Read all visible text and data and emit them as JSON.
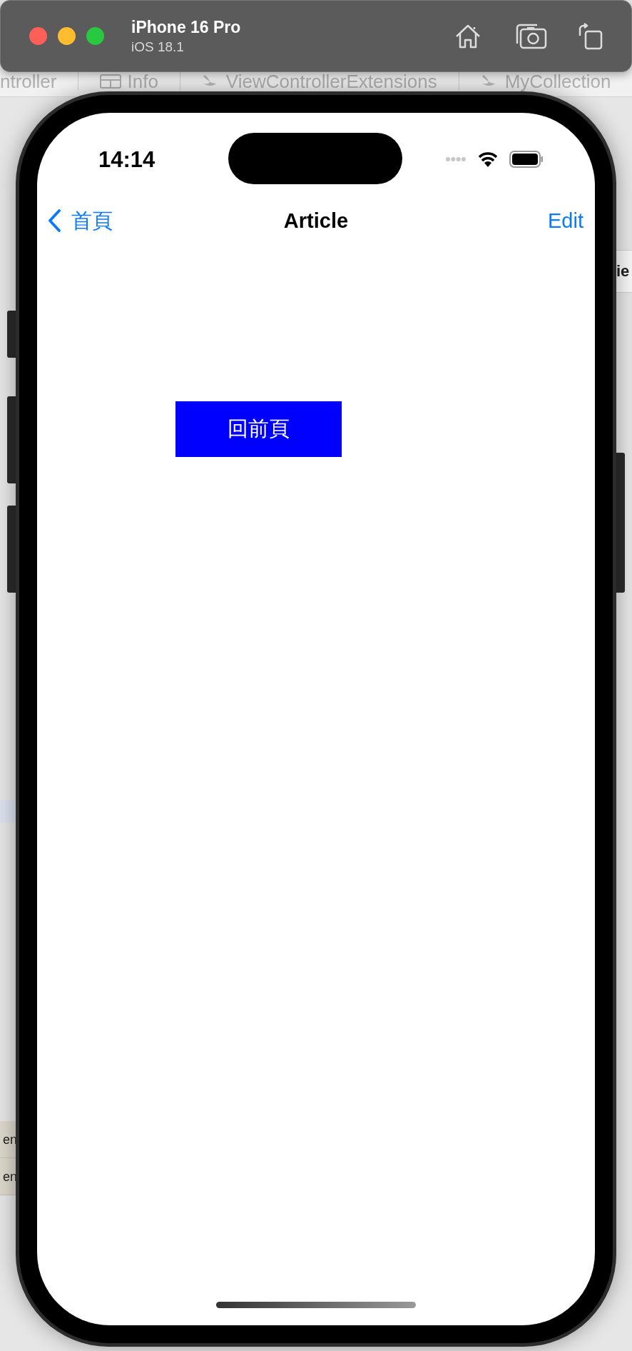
{
  "simulator": {
    "device": "iPhone 16 Pro",
    "os": "iOS 18.1"
  },
  "background_window": {
    "tabs": [
      {
        "label": "ntroller",
        "kind": "plain"
      },
      {
        "label": "Info",
        "kind": "table"
      },
      {
        "label": "ViewControllerExtensions",
        "kind": "swift"
      },
      {
        "label": "MyCollection",
        "kind": "swift"
      }
    ],
    "side_text": "ie",
    "rows": [
      {
        "label": "en"
      },
      {
        "label": "en"
      }
    ]
  },
  "status_bar": {
    "time": "14:14"
  },
  "nav_bar": {
    "back": "首頁",
    "title": "Article",
    "action": "Edit"
  },
  "button": {
    "label": "回前頁"
  }
}
